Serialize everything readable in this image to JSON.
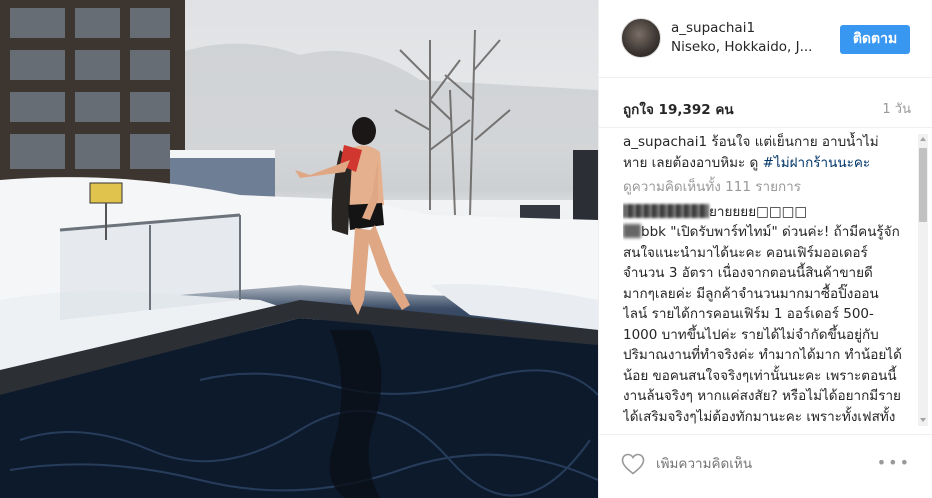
{
  "post": {
    "username": "a_supachai1",
    "location": "Niseko, Hokkaido, J...",
    "follow_label": "ติดตาม",
    "likes": "ถูกใจ 19,392 คน",
    "time_ago": "1 วัน",
    "caption_user": "a_supachai1",
    "caption_text": " ร้อนใจ แต่เย็นกาย อาบน้ำไม่หาย เลยต้องอาบหิมะ ดู ",
    "caption_hashtag": "#ไม่ฝากร้านนะคะ",
    "view_all_comments": "ดูความคิดเห็นทั้ง 111 รายการ",
    "comment1_text": "ยายยยย□□□□",
    "comment2_user_suffix": "bbk",
    "comment2_text": " \"เปิดรับพาร์ทไทม์\" ด่วนค่ะ! ถ้ามีคนรู้จักสนใจแนะนำมาได้นะคะ คอนเฟิร์มออเดอร์ จำนวน 3 อัตรา เนื่องจากตอนนี้สินค้าขายดีมากๆเลยค่ะ มีลูกค้าจำนวนมากมาซื้อปิ๊งออนไลน์ รายได้การคอนเฟิร์ม 1 ออร์เดอร์ 500-1000 บาทขึ้นไปค่ะ รายได้ไม่จำกัดขึ้นอยู่กับปริมาณงานที่ทำจริงค่ะ ทำมากได้มาก ทำน้อยได้น้อย ขอคนสนใจจริงๆเท่านั้นนะคะ เพราะตอนนี้งานล้นจริงๆ หากแค่สงสัย? หรือไม่ได้อยากมีรายได้เสริมจริงๆไม่ต้องทักมานะคะ เพราะทั้งเฟสทั้งไลน์บ่อมไม่มีแอดมินค่ะ",
    "add_comment_placeholder": "เพิ่มความคิดเห็น",
    "more_label": "•••"
  },
  "colors": {
    "follow_button": "#3897f0",
    "hashtag": "#003569",
    "muted_text": "#999999"
  },
  "icons": [
    "heart-icon",
    "more-options-icon",
    "avatar"
  ]
}
